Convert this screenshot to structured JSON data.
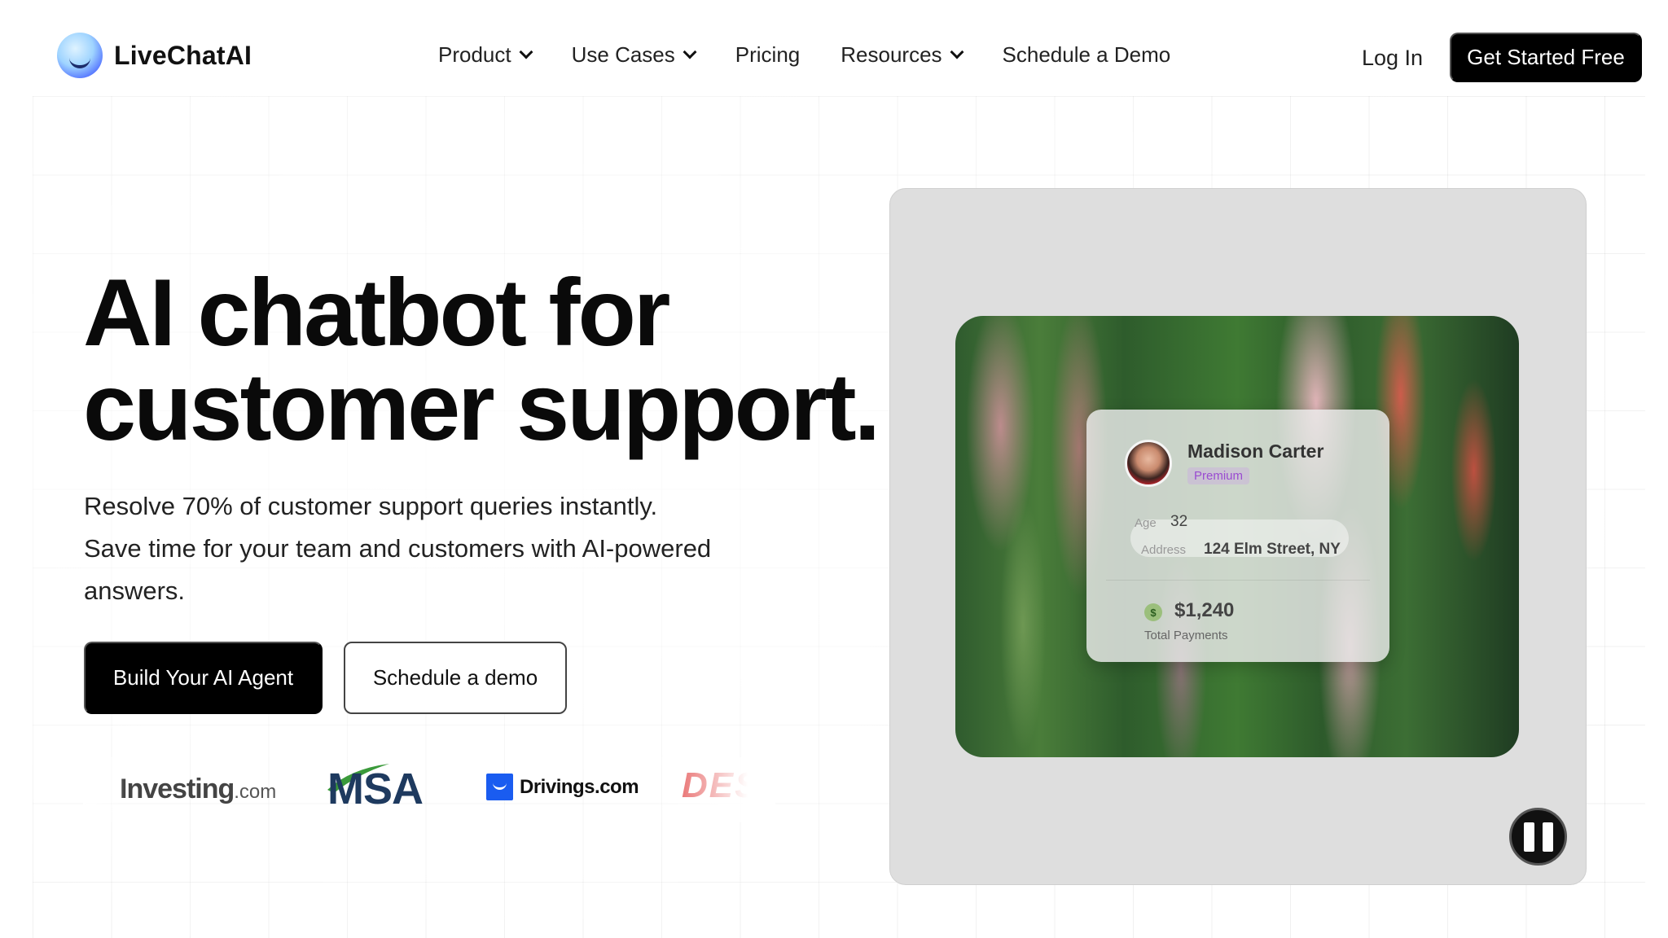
{
  "header": {
    "logo_text": "LiveChatAI",
    "nav": [
      {
        "label": "Product",
        "has_dropdown": true
      },
      {
        "label": "Use Cases",
        "has_dropdown": true
      },
      {
        "label": "Pricing",
        "has_dropdown": false
      },
      {
        "label": "Resources",
        "has_dropdown": true
      },
      {
        "label": "Schedule a Demo",
        "has_dropdown": false
      }
    ],
    "login_label": "Log In",
    "cta_label": "Get Started Free"
  },
  "hero": {
    "title_line1": "AI chatbot for",
    "title_line2": "customer support.",
    "subtitle_line1": "Resolve 70% of customer support queries instantly.",
    "subtitle_line2": "Save time for your team and customers with AI-powered answers.",
    "primary_button": "Build Your AI Agent",
    "secondary_button": "Schedule a demo"
  },
  "brands": {
    "investing": "Investing",
    "investing_suffix": ".com",
    "msa": "MSA",
    "drivings": "Drivings.com",
    "des": "DES"
  },
  "video_card": {
    "name": "Madison Carter",
    "badge": "Premium",
    "age_label": "Age",
    "age": "32",
    "address_label": "Address",
    "address": "124 Elm Street, NY",
    "amount": "$1,240",
    "amount_label": "Total Payments"
  },
  "colors": {
    "accent": "#000000",
    "badge_text": "#9a4bd1",
    "drivings_blue": "#1a5cf0",
    "des_red": "#e03a3a",
    "msa_green": "#3a9a3a"
  }
}
